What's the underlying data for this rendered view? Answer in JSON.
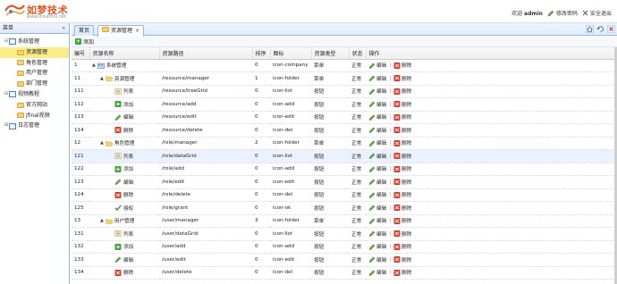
{
  "header": {
    "logo_title": "如梦技术",
    "logo_url": "www.dreamlu.net",
    "welcome_prefix": "欢迎",
    "username": "admin",
    "change_password": "修改密码",
    "logout": "安全退出"
  },
  "sidebar": {
    "title": "菜单",
    "collapse": "«",
    "items": [
      {
        "label": "系统管理",
        "level": 0,
        "toggle": "⊟",
        "icon": "folder-icon"
      },
      {
        "label": "资源管理",
        "level": 1,
        "toggle": "",
        "icon": "folder-icon",
        "selected": true
      },
      {
        "label": "角色管理",
        "level": 1,
        "toggle": "",
        "icon": "folder-icon"
      },
      {
        "label": "用户管理",
        "level": 1,
        "toggle": "",
        "icon": "folder-icon"
      },
      {
        "label": "部门管理",
        "level": 1,
        "toggle": "",
        "icon": "folder-icon"
      },
      {
        "label": "视频教程",
        "level": 0,
        "toggle": "⊟",
        "icon": "folder-icon"
      },
      {
        "label": "官方网站",
        "level": 1,
        "toggle": "",
        "icon": "folder-icon"
      },
      {
        "label": "jfinal视频",
        "level": 1,
        "toggle": "",
        "icon": "folder-icon"
      },
      {
        "label": "日志管理",
        "level": 0,
        "toggle": "⊞",
        "icon": "folder-icon"
      }
    ]
  },
  "tabs": [
    {
      "label": "首页",
      "closable": false,
      "active": false
    },
    {
      "label": "资源管理",
      "closable": true,
      "active": true,
      "close": "×"
    }
  ],
  "toolbar": {
    "add_label": "添加",
    "add_glyph": "+"
  },
  "grid": {
    "columns": [
      "编号",
      "资源名称",
      "资源路径",
      "排序",
      "图标",
      "资源类型",
      "状态",
      "操作"
    ],
    "edit_label": "编辑",
    "delete_label": "删除",
    "rows": [
      {
        "id": "1",
        "name": "系统管理",
        "level": 0,
        "toggle": "▲",
        "icon": "company",
        "path": "",
        "sort": "0",
        "icon_name": "icon-company",
        "type": "菜单",
        "status": "正常"
      },
      {
        "id": "11",
        "name": "资源管理",
        "level": 1,
        "toggle": "▲",
        "icon": "folder",
        "path": "/resource/manager",
        "sort": "1",
        "icon_name": "icon-folder",
        "type": "菜单",
        "status": "正常"
      },
      {
        "id": "111",
        "name": "列表",
        "level": 2,
        "toggle": "",
        "icon": "list",
        "path": "/resource/treeGrid",
        "sort": "0",
        "icon_name": "icon-list",
        "type": "按钮",
        "status": "正常"
      },
      {
        "id": "112",
        "name": "添加",
        "level": 2,
        "toggle": "",
        "icon": "add",
        "path": "/resource/add",
        "sort": "0",
        "icon_name": "icon-add",
        "type": "按钮",
        "status": "正常"
      },
      {
        "id": "113",
        "name": "编辑",
        "level": 2,
        "toggle": "",
        "icon": "edit",
        "path": "/resource/edit",
        "sort": "0",
        "icon_name": "icon-edit",
        "type": "按钮",
        "status": "正常"
      },
      {
        "id": "114",
        "name": "删除",
        "level": 2,
        "toggle": "",
        "icon": "del",
        "path": "/resource/delete",
        "sort": "0",
        "icon_name": "icon-del",
        "type": "按钮",
        "status": "正常"
      },
      {
        "id": "12",
        "name": "角色管理",
        "level": 1,
        "toggle": "▲",
        "icon": "folder",
        "path": "/role/manager",
        "sort": "2",
        "icon_name": "icon-folder",
        "type": "菜单",
        "status": "正常"
      },
      {
        "id": "121",
        "name": "列表",
        "level": 2,
        "toggle": "",
        "icon": "list",
        "path": "/role/dataGrid",
        "sort": "0",
        "icon_name": "icon-list",
        "type": "按钮",
        "status": "正常",
        "highlight": true
      },
      {
        "id": "122",
        "name": "添加",
        "level": 2,
        "toggle": "",
        "icon": "add",
        "path": "/role/add",
        "sort": "0",
        "icon_name": "icon-add",
        "type": "按钮",
        "status": "正常"
      },
      {
        "id": "123",
        "name": "编辑",
        "level": 2,
        "toggle": "",
        "icon": "edit",
        "path": "/role/edit",
        "sort": "0",
        "icon_name": "icon-edit",
        "type": "按钮",
        "status": "正常"
      },
      {
        "id": "124",
        "name": "删除",
        "level": 2,
        "toggle": "",
        "icon": "del",
        "path": "/role/delete",
        "sort": "0",
        "icon_name": "icon-del",
        "type": "按钮",
        "status": "正常"
      },
      {
        "id": "125",
        "name": "授权",
        "level": 2,
        "toggle": "",
        "icon": "ok",
        "path": "/role/grant",
        "sort": "0",
        "icon_name": "icon-ok",
        "type": "按钮",
        "status": "正常"
      },
      {
        "id": "13",
        "name": "用户管理",
        "level": 1,
        "toggle": "▲",
        "icon": "folder",
        "path": "/user/manager",
        "sort": "3",
        "icon_name": "icon-folder",
        "type": "菜单",
        "status": "正常"
      },
      {
        "id": "131",
        "name": "列表",
        "level": 2,
        "toggle": "",
        "icon": "list",
        "path": "/user/dataGrid",
        "sort": "0",
        "icon_name": "icon-list",
        "type": "按钮",
        "status": "正常"
      },
      {
        "id": "132",
        "name": "添加",
        "level": 2,
        "toggle": "",
        "icon": "add",
        "path": "/user/add",
        "sort": "0",
        "icon_name": "icon-add",
        "type": "按钮",
        "status": "正常"
      },
      {
        "id": "133",
        "name": "编辑",
        "level": 2,
        "toggle": "",
        "icon": "edit",
        "path": "/user/edit",
        "sort": "0",
        "icon_name": "icon-edit",
        "type": "按钮",
        "status": "正常"
      },
      {
        "id": "134",
        "name": "删除",
        "level": 2,
        "toggle": "",
        "icon": "del",
        "path": "/user/delete",
        "sort": "0",
        "icon_name": "icon-del",
        "type": "按钮",
        "status": "正常"
      }
    ]
  },
  "colors": {
    "accent": "#e8541e",
    "border": "#95b8e7",
    "selected": "#fbec88",
    "add": "#3ca634",
    "delete": "#d93b2b"
  }
}
